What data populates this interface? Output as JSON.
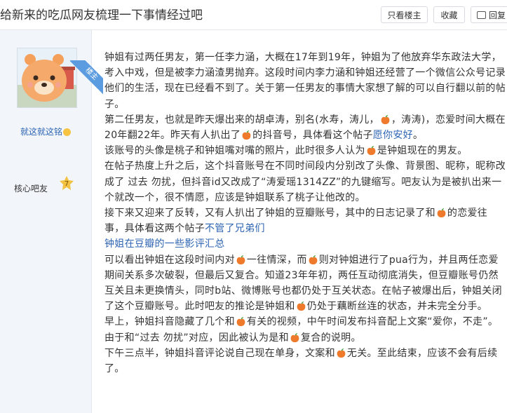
{
  "header": {
    "title": "给新来的吃瓜网友梳理一下事情经过吧",
    "buttons": {
      "only_op": "只看楼主",
      "favorite": "收藏",
      "reply": "回复"
    }
  },
  "author": {
    "badge_ribbon": "楼主",
    "username": "就这就这铭",
    "member_label": "核心吧友",
    "level": "7"
  },
  "post": {
    "p1": "钟姐有过两任男友，第一任李力涵，大概在17年到19年，钟姐为了他放弃华东政法大学，考入中戏，但是被李力涵渣男抛弃。这段时间内李力涵和钟姐还经营了一个微信公众号记录他们的生活，现在已经看不到了。关于第一任男友的事情大家想了解的可以自行翻以前的帖子。",
    "p2a": "第二任男友，也就是昨天爆出来的胡卓涛，别名(水寿，涛儿，",
    "p2b": "，涛涛)，恋爱时间大概在20年翻22年。昨天有人扒出了",
    "p2c": "的抖音号，具体看这个帖子",
    "p2_link": "愿你安好",
    "p2d": "。",
    "p3a": "该账号的头像是桃子和钟姐嘴对嘴的照片，此时很多人认为",
    "p3b": "是钟姐现在的男友。",
    "p4": "在帖子热度上升之后，这个抖音账号在不同时间段内分别改了头像、背景图、昵称，昵称改成了 过去 勿扰，但抖音id又改成了“涛爱瑶1314ZZ”的九键缩写。吧友认为是被扒出来一个就改一个，很不情愿，应该是钟姐联系了桃子让他改的。",
    "p5a": "接下来又迎来了反转，又有人扒出了钟姐的豆瓣账号，其中的日志记录了和",
    "p5b": "的恋爱往事，具体看这两个帖子",
    "p5_link": "不管了兄弟们",
    "link2": "钟姐在豆瓣的一些影评汇总",
    "p6a": "可以看出钟姐在这段时间内对",
    "p6b": "一往情深，而",
    "p6c": "则对钟姐进行了pua行为，并且两任恋爱期间关系多次破裂，但最后又复合。知道23年年初，两任互动彻底消失，但豆瓣账号仍然互关且未更换情头，同时b站、微博账号也都仍处于互关状态。在帖子被爆出后，钟姐关闭了这个豆瓣账号。此时吧友的推论是钟姐和",
    "p6d": "仍处于藕断丝连的状态，并未完全分手。",
    "p7a": "早上，钟姐抖音隐藏了几个和",
    "p7b": "有关的视频，中午时间发布抖音配上文案“爱你，不走”。由于和“过去 勿扰”对应，因此被认为是和",
    "p7c": "复合的说明。",
    "p8a": "下午三点半，钟姐抖音评论说自己现在单身，文案和",
    "p8b": "无关。至此结束，应该不会有后续了。"
  },
  "icons": {
    "peach": "peach-emoji-icon",
    "reply": "reply-icon",
    "level_badge": "level-badge-icon"
  },
  "colors": {
    "link": "#2d64b3",
    "sidebar_bg": "#f2f6fb",
    "ribbon": "#5b9be0",
    "peach": "#f07a2b"
  }
}
